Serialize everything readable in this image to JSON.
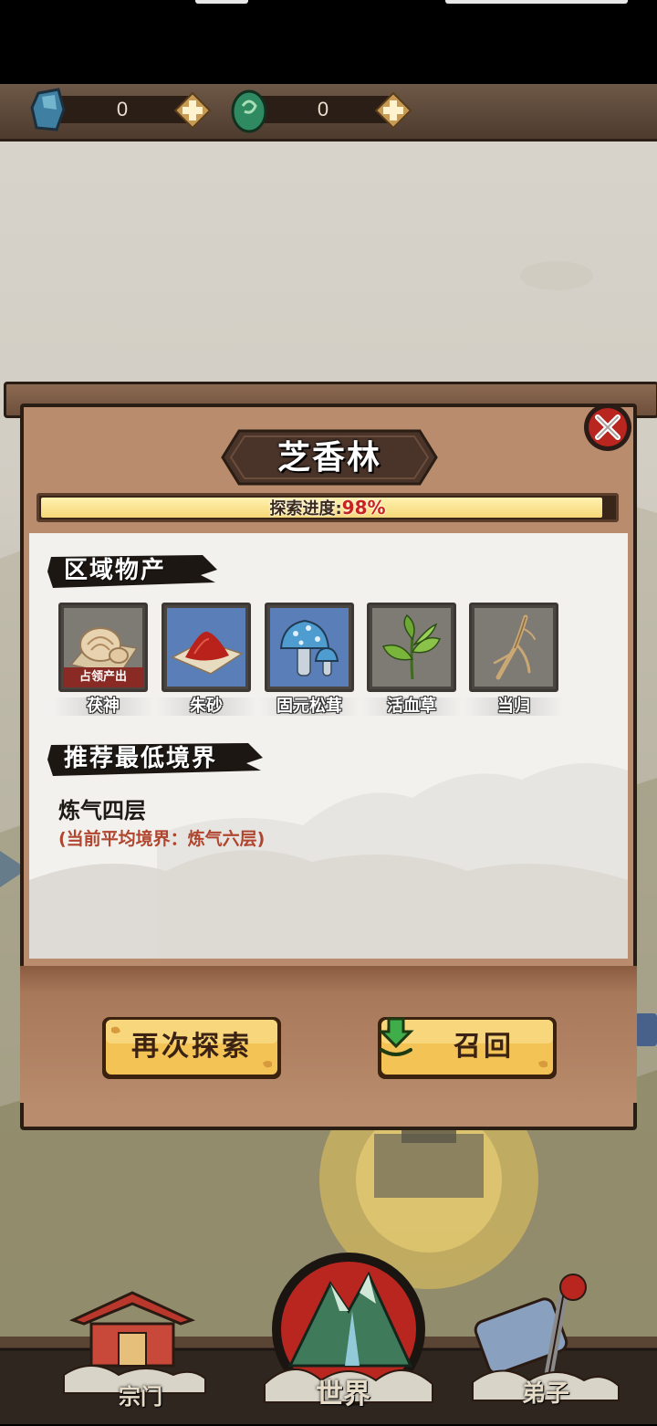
{
  "resources": [
    {
      "icon": "blue-spirit-stone-icon",
      "value": "0"
    },
    {
      "icon": "green-jade-icon",
      "value": "0"
    }
  ],
  "modal": {
    "title": "芝香林",
    "progress": {
      "label": "探索进度:",
      "percent_text": "98%",
      "fraction": 0.98
    },
    "products_section": {
      "title": "区域物产",
      "items": [
        {
          "name": "茯神",
          "icon": "fushen-fungus-icon",
          "tag": "占领产出",
          "rarity": "common"
        },
        {
          "name": "朱砂",
          "icon": "cinnabar-icon",
          "tag": "",
          "rarity": "rare"
        },
        {
          "name": "固元松茸",
          "icon": "blue-mushroom-icon",
          "tag": "",
          "rarity": "rare"
        },
        {
          "name": "活血草",
          "icon": "herb-leaves-icon",
          "tag": "",
          "rarity": "common"
        },
        {
          "name": "当归",
          "icon": "angelica-root-icon",
          "tag": "",
          "rarity": "common"
        }
      ]
    },
    "realm_section": {
      "title": "推荐最低境界",
      "required": "炼气四层",
      "current": "(当前平均境界：炼气六层)"
    },
    "buttons": {
      "explore_again": "再次探索",
      "recall": "召回"
    }
  },
  "nav": {
    "sect": "宗门",
    "world": "世界",
    "disciples": "弟子"
  },
  "colors": {
    "accent_red": "#c9231e",
    "rare_frame": "#5a7fb8",
    "common_frame": "#7e7a74",
    "button_gold": "#f3c356"
  }
}
